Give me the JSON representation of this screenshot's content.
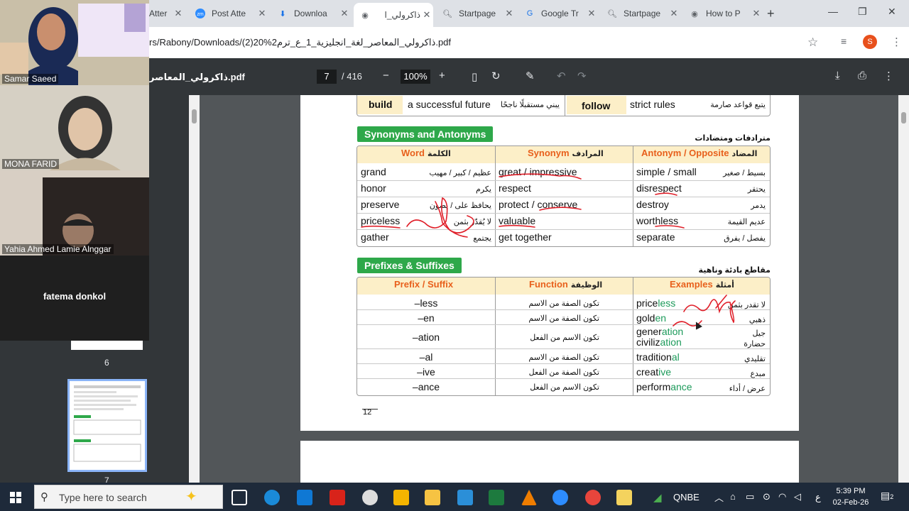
{
  "browser": {
    "tabs": [
      {
        "title": "Post Atte",
        "icon": "zoom-icon"
      },
      {
        "title": "Downloa",
        "icon": "download-icon"
      },
      {
        "title": "ذاكرولي_ا",
        "icon": "globe-icon",
        "active": true
      },
      {
        "title": "Startpage",
        "icon": "search-icon"
      },
      {
        "title": "Google Tr",
        "icon": "translate-icon"
      },
      {
        "title": "Startpage",
        "icon": "search-icon"
      },
      {
        "title": "How to P",
        "icon": "globe-icon"
      }
    ],
    "partial_tab_title": "Atter",
    "url": "rs/Rabony/Downloads/(2)20%2ذاكرولي_المعاصر_لغة_انجليزية_1_ع_ترم.pdf",
    "profile_initial": "S"
  },
  "pdf_toolbar": {
    "filename": "ذاكرولي_المعاصر.pdf",
    "current_page": "7",
    "total_pages": "/ 416",
    "zoom": "100%"
  },
  "video_tiles": [
    {
      "name": "Samar Saeed"
    },
    {
      "name": "MONA FARID"
    },
    {
      "name": "Yahia Ahmed Lamie Alnggar"
    },
    {
      "name": "fatema donkol"
    }
  ],
  "thumbnails": {
    "page6": "6",
    "page7": "7"
  },
  "pdf_page": {
    "top_row": {
      "verb1": "build",
      "phrase1": "a successful future",
      "arabic1": "يبني مستقبلًا ناجحًا",
      "verb2": "follow",
      "phrase2": "strict rules",
      "arabic2": "يتبع قواعد صارمة"
    },
    "synonyms_title": "Synonyms and Antonyms",
    "synonyms_title_ar": "مترادفات ومتضادات",
    "syn_headers": {
      "word": "Word",
      "word_ar": "الكلمة",
      "synonym": "Synonym",
      "synonym_ar": "المرادف",
      "antonym": "Antonym / Opposite",
      "antonym_ar": "المضاد"
    },
    "syn_rows": [
      {
        "word": "grand",
        "word_ar": "عظيم / كبير / مهيب",
        "synonym": "great / impressive",
        "antonym": "simple / small",
        "antonym_ar": "بسيط / صغير"
      },
      {
        "word": "honor",
        "word_ar": "يكرم",
        "synonym": "respect",
        "antonym": "disrespect",
        "antonym_ar": "يحتقر"
      },
      {
        "word": "preserve",
        "word_ar": "يحافظ على / يصون",
        "synonym": "protect / conserve",
        "antonym": "destroy",
        "antonym_ar": "يدمر"
      },
      {
        "word": "priceless",
        "word_ar": "لا يُقدّر بثمن",
        "synonym": "valuable",
        "antonym": "worthless",
        "antonym_ar": "عديم القيمة"
      },
      {
        "word": "gather",
        "word_ar": "يجتمع",
        "synonym": "get together",
        "antonym": "separate",
        "antonym_ar": "يفصل / يفرق"
      }
    ],
    "prefix_title": "Prefixes & Suffixes",
    "prefix_title_ar": "مقاطع بادئة وناهية",
    "pre_headers": {
      "prefix": "Prefix / Suffix",
      "function": "Function",
      "function_ar": "الوظيفة",
      "examples": "Examples",
      "examples_ar": "أمثلة"
    },
    "pre_rows": [
      {
        "suffix": "–less",
        "function_ar": "تكون الصفة من الاسم",
        "example_stem": "price",
        "example_suffix": "less",
        "example_ar": "لا تقدر بثمن"
      },
      {
        "suffix": "–en",
        "function_ar": "تكون الصفة من الاسم",
        "example_stem": "gold",
        "example_suffix": "en",
        "example_ar": "ذهبي"
      },
      {
        "suffix": "–ation",
        "function_ar": "تكون الاسم من الفعل",
        "example_stem": "gener",
        "example_suffix": "ation",
        "example_ar": "جيل",
        "example2_stem": "civiliz",
        "example2_suffix": "ation",
        "example2_ar": "حضارة"
      },
      {
        "suffix": "–al",
        "function_ar": "تكون الصفة من الاسم",
        "example_stem": "tradition",
        "example_suffix": "al",
        "example_ar": "تقليدي"
      },
      {
        "suffix": "–ive",
        "function_ar": "تكون الصفة من الفعل",
        "example_stem": "creat",
        "example_suffix": "ive",
        "example_ar": "مبدع"
      },
      {
        "suffix": "–ance",
        "function_ar": "تكون الاسم من الفعل",
        "example_stem": "perform",
        "example_suffix": "ance",
        "example_ar": "عرض / أداء"
      }
    ],
    "page_number": "12"
  },
  "taskbar": {
    "search_placeholder": "Type here to search",
    "tray_label": "QNBE",
    "time": "5:39 PM",
    "date": "02-Feb-26",
    "lang": "ع",
    "notif_count": "2"
  },
  "colors": {
    "section_green": "#2ea84a",
    "header_orange": "#e8601c",
    "suffix_green": "#1c9a5a",
    "pen_red": "#e0202a"
  }
}
